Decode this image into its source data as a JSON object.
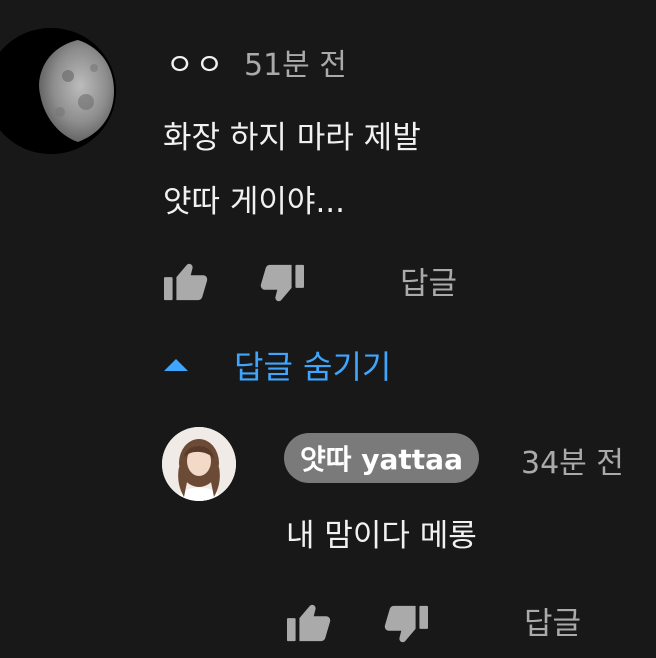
{
  "colors": {
    "background": "#181818",
    "text_primary": "#f1f1f1",
    "text_secondary": "#aaaaaa",
    "link_blue": "#3ea6ff",
    "author_chip_bg": "#7a7a7a"
  },
  "comment": {
    "author": "ㅇㅇ",
    "time": "51분 전",
    "text": "화장 하지 마라 제발\n얏따 게이야...",
    "avatar_icon": "moon-avatar",
    "like_icon": "thumbs-up-icon",
    "dislike_icon": "thumbs-down-icon",
    "reply_label": "답글"
  },
  "replies_toggle": {
    "icon": "caret-up-icon",
    "label": "답글 숨기기"
  },
  "reply": {
    "author": "얏따 yattaa",
    "time": "34분 전",
    "text": "내 맘이다 메롱",
    "avatar_icon": "user-avatar",
    "like_icon": "thumbs-up-icon",
    "dislike_icon": "thumbs-down-icon",
    "reply_label": "답글"
  }
}
